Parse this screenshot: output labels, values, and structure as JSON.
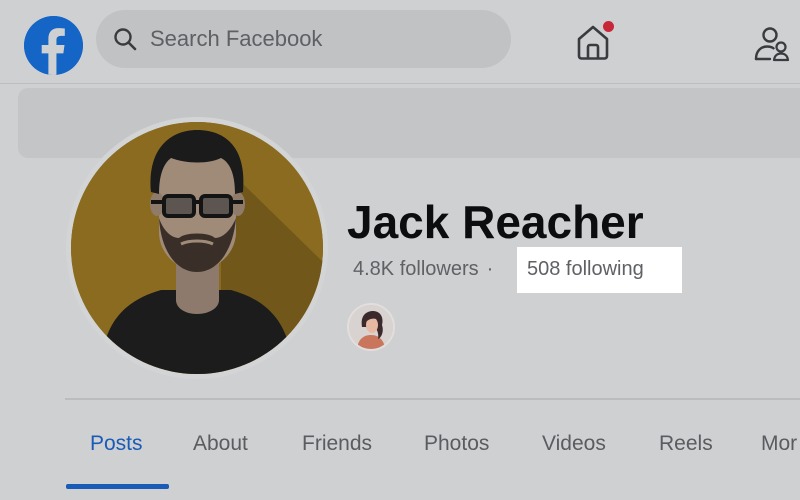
{
  "header": {
    "logo": "facebook-logo-icon",
    "search": {
      "placeholder": "Search Facebook",
      "icon": "search-icon"
    },
    "home": {
      "icon": "home-icon",
      "has_notification_dot": true
    },
    "friends": {
      "icon": "friends-icon"
    }
  },
  "profile": {
    "name": "Jack Reacher",
    "followers": "4.8K followers",
    "separator": "·",
    "following": "508 following"
  },
  "tabs": [
    {
      "label": "Posts",
      "active": true
    },
    {
      "label": "About",
      "active": false
    },
    {
      "label": "Friends",
      "active": false
    },
    {
      "label": "Photos",
      "active": false
    },
    {
      "label": "Videos",
      "active": false
    },
    {
      "label": "Reels",
      "active": false
    },
    {
      "label": "Mor",
      "active": false
    }
  ],
  "colors": {
    "accent": "#1a5bb8",
    "facebook_blue": "#1565c7",
    "notification": "#c8273a"
  }
}
